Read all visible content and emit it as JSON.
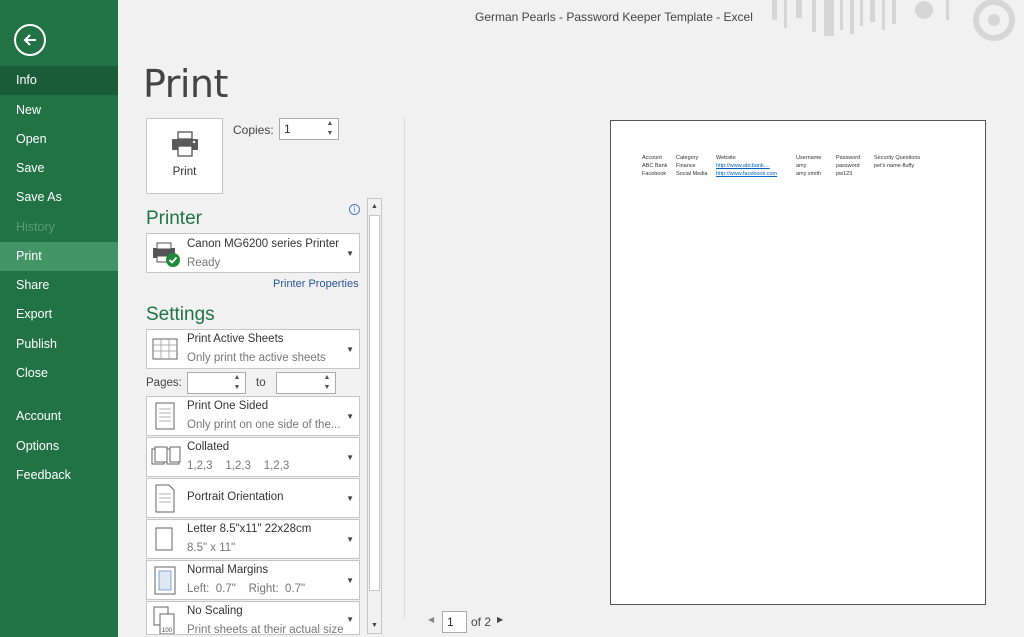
{
  "window": {
    "title": "German Pearls - Password Keeper Template - Excel"
  },
  "sidebar": {
    "items": [
      {
        "label": "Info",
        "state": "active"
      },
      {
        "label": "New"
      },
      {
        "label": "Open"
      },
      {
        "label": "Save"
      },
      {
        "label": "Save As"
      },
      {
        "label": "History",
        "state": "disabled"
      },
      {
        "label": "Print",
        "state": "selected"
      },
      {
        "label": "Share"
      },
      {
        "label": "Export"
      },
      {
        "label": "Publish"
      },
      {
        "label": "Close"
      },
      {
        "label": "Account"
      },
      {
        "label": "Options"
      },
      {
        "label": "Feedback"
      }
    ]
  },
  "print": {
    "heading": "Print",
    "button_label": "Print",
    "copies_label": "Copies:",
    "copies_value": "1"
  },
  "printer": {
    "heading": "Printer",
    "name": "Canon MG6200 series Printer",
    "status": "Ready",
    "properties_link": "Printer Properties"
  },
  "settings": {
    "heading": "Settings",
    "print_what": {
      "title": "Print Active Sheets",
      "subtitle": "Only print the active sheets"
    },
    "pages_label": "Pages:",
    "pages_to_label": "to",
    "pages_from": "",
    "pages_to": "",
    "sides": {
      "title": "Print One Sided",
      "subtitle": "Only print on one side of the..."
    },
    "collation": {
      "title": "Collated",
      "subtitle": "1,2,3    1,2,3    1,2,3"
    },
    "orientation": {
      "title": "Portrait Orientation"
    },
    "paper": {
      "title": "Letter 8.5\"x11\" 22x28cm",
      "subtitle": "8.5\" x 11\""
    },
    "margins": {
      "title": "Normal Margins",
      "subtitle": "Left:  0.7\"    Right:  0.7\""
    },
    "scaling": {
      "title": "No Scaling",
      "subtitle": "Print sheets at their actual size"
    }
  },
  "preview": {
    "headers": [
      "Account",
      "Category",
      "Website",
      "Username",
      "Password",
      "Security Questions"
    ],
    "rows": [
      [
        "ABC Bank",
        "Finance",
        "http://www.abcbank....",
        "amy",
        "password",
        "pet's name-fluffy"
      ],
      [
        "Facebook",
        "Social Media",
        "http://www.facebook.com",
        "amy smith",
        "pw123",
        ""
      ]
    ]
  },
  "page_nav": {
    "current": "1",
    "of_text": "of 2"
  },
  "colors": {
    "accent": "#217346",
    "sidebar_selected": "#439467",
    "link": "#2b579a"
  }
}
